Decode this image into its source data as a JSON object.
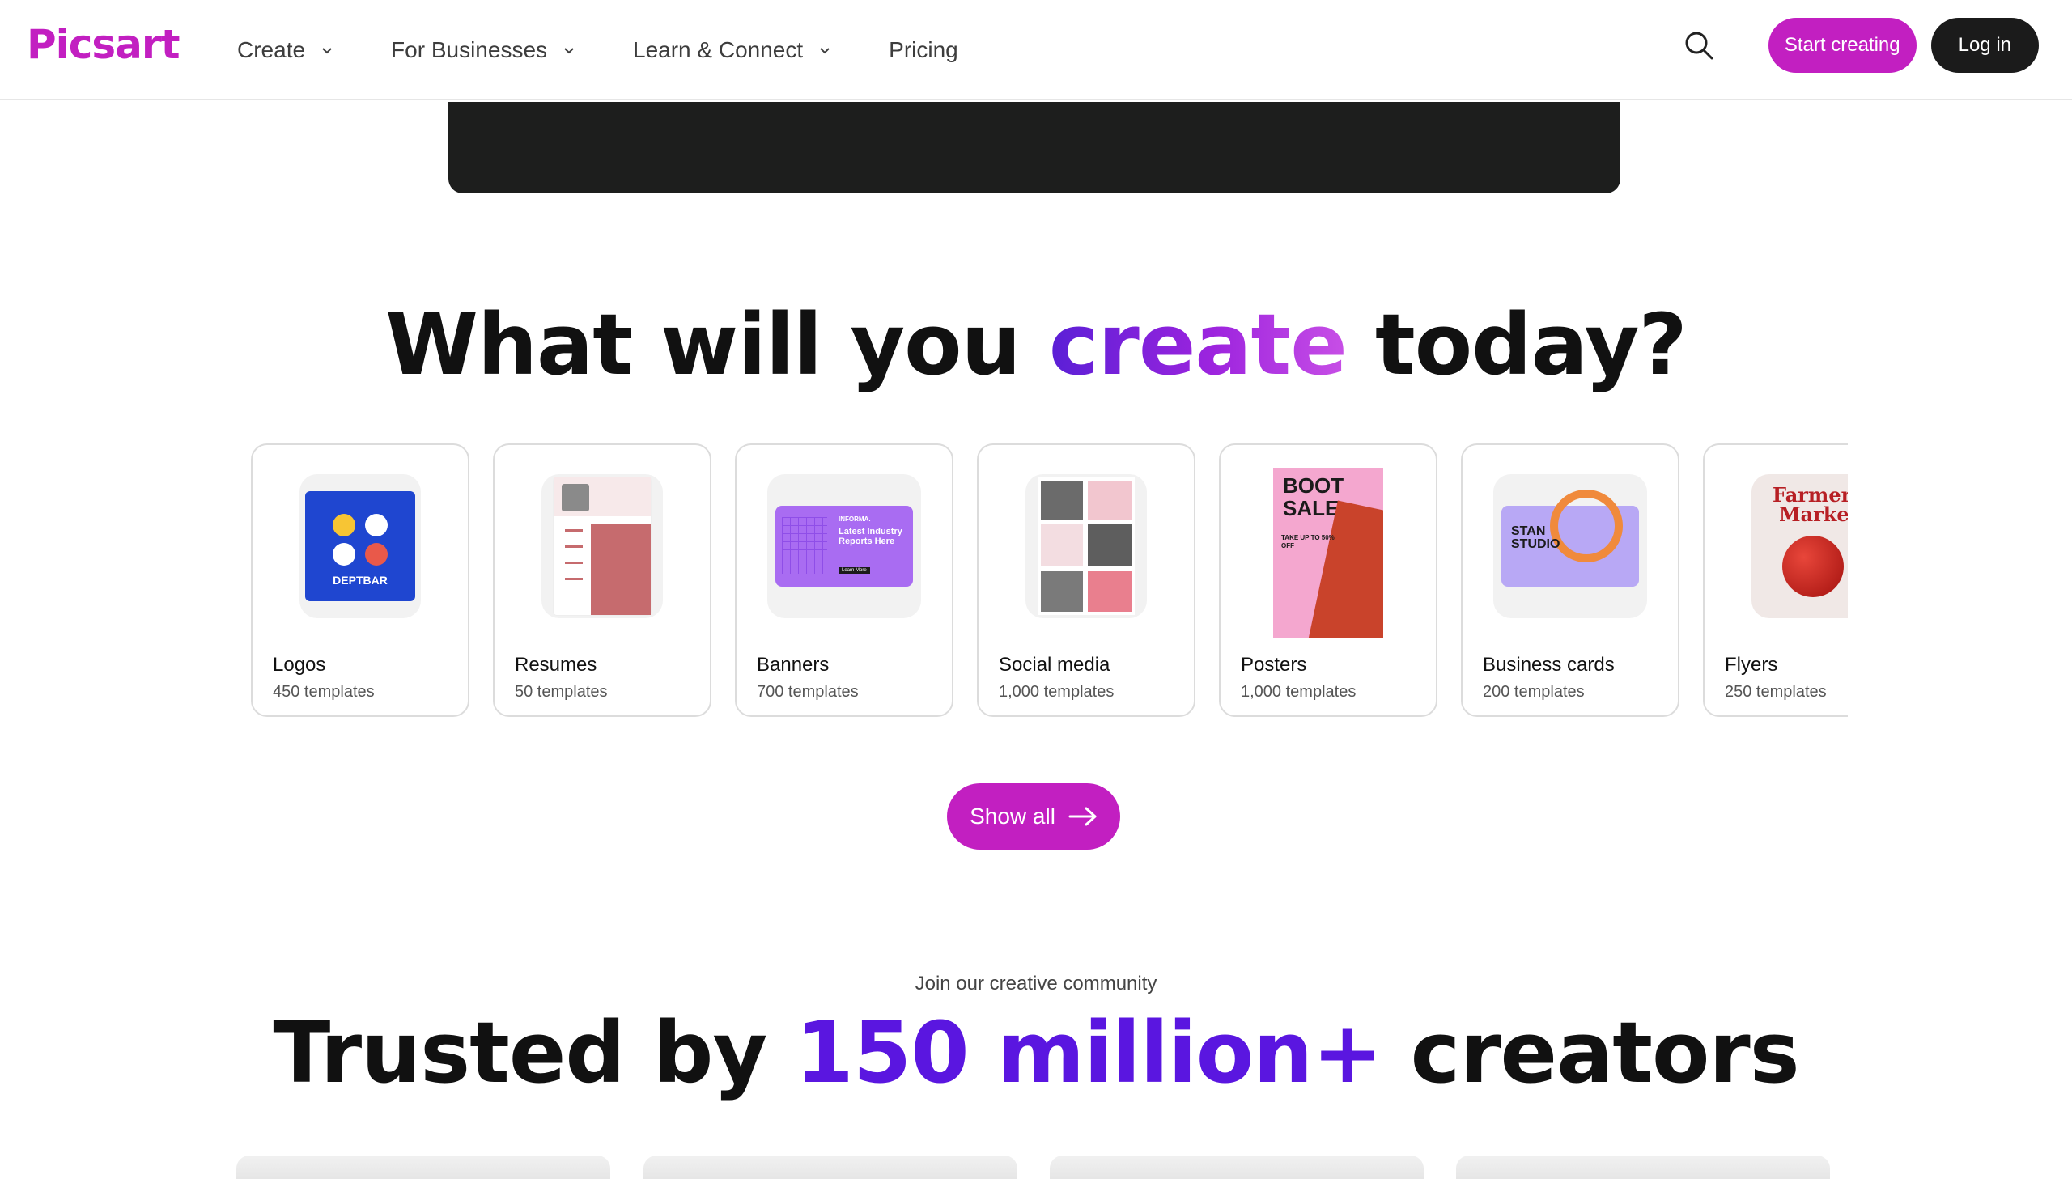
{
  "brand": {
    "name": "Picsart",
    "color": "#c21fc1"
  },
  "nav": {
    "items": [
      {
        "label": "Create",
        "has_dropdown": true
      },
      {
        "label": "For Businesses",
        "has_dropdown": true
      },
      {
        "label": "Learn & Connect",
        "has_dropdown": true
      },
      {
        "label": "Pricing",
        "has_dropdown": false
      }
    ],
    "search_icon": "search-icon",
    "start_label": "Start creating",
    "login_label": "Log in"
  },
  "hero": {
    "heading_before": "What will you",
    "heading_accent": "create",
    "heading_after": "today?"
  },
  "cards": [
    {
      "title": "Logos",
      "count": "450 templates",
      "thumb": {
        "brand": "DEPTBAR"
      }
    },
    {
      "title": "Resumes",
      "count": "50 templates"
    },
    {
      "title": "Banners",
      "count": "700 templates",
      "thumb": {
        "line1": "INFORMA.",
        "line2": "Latest Industry Reports Here",
        "button": "Learn More"
      }
    },
    {
      "title": "Social media",
      "count": "1,000 templates"
    },
    {
      "title": "Posters",
      "count": "1,000 templates",
      "thumb": {
        "line1": "BOOT",
        "line2": "SALE",
        "sub": "TAKE UP TO 50% OFF"
      }
    },
    {
      "title": "Business cards",
      "count": "200 templates",
      "thumb": {
        "line1": "STAN",
        "line2": "STUDIO"
      }
    },
    {
      "title": "Flyers",
      "count": "250 templates",
      "thumb": {
        "line1": "Farmers",
        "line2": "Market"
      }
    }
  ],
  "show_all": {
    "label": "Show all",
    "icon": "arrow-right-icon"
  },
  "community": {
    "kicker": "Join our creative community",
    "title_before": "Trusted by",
    "title_accent": "150 million+",
    "title_after": "creators",
    "accent_color": "#5a16e0"
  }
}
